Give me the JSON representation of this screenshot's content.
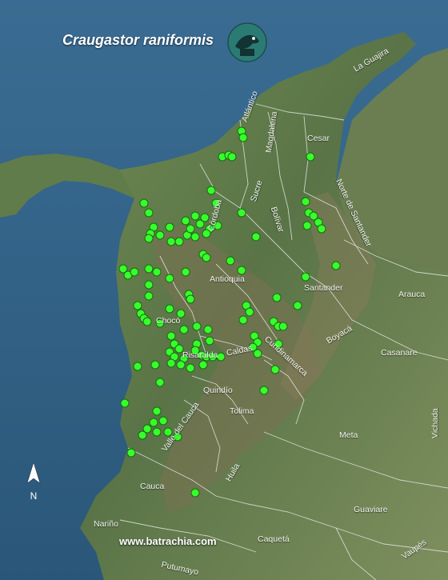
{
  "title": "Craugastor raniformis",
  "website": "www.batrachia.com",
  "north_label": "N",
  "logo_icon": "frog-logo-icon",
  "colors": {
    "ocean": "#2f5f86",
    "land": "#5b7a4c",
    "highland": "#6e6a4e",
    "lowland_east": "#7d8e5c",
    "border": "#e8ebe4",
    "occurrence": "#37ff2b",
    "occurrence_outline": "#1a6a12",
    "logo_bg": "#2b7b74"
  },
  "departments": [
    "La Guajira",
    "Atlántico",
    "Magdalena",
    "Cesar",
    "Sucre",
    "Córdoba",
    "Bolívar",
    "Norte de Santander",
    "Antioquia",
    "Santander",
    "Arauca",
    "Chocó",
    "Boyacá",
    "Casanare",
    "Risaralda",
    "Caldas",
    "Cundinamarca",
    "Quindío",
    "Tolima",
    "Valle del Cauca",
    "Vichada",
    "Meta",
    "Huila",
    "Cauca",
    "Guaviare",
    "Nariño",
    "Caquetá",
    "Putumayo",
    "Vaupés"
  ]
}
